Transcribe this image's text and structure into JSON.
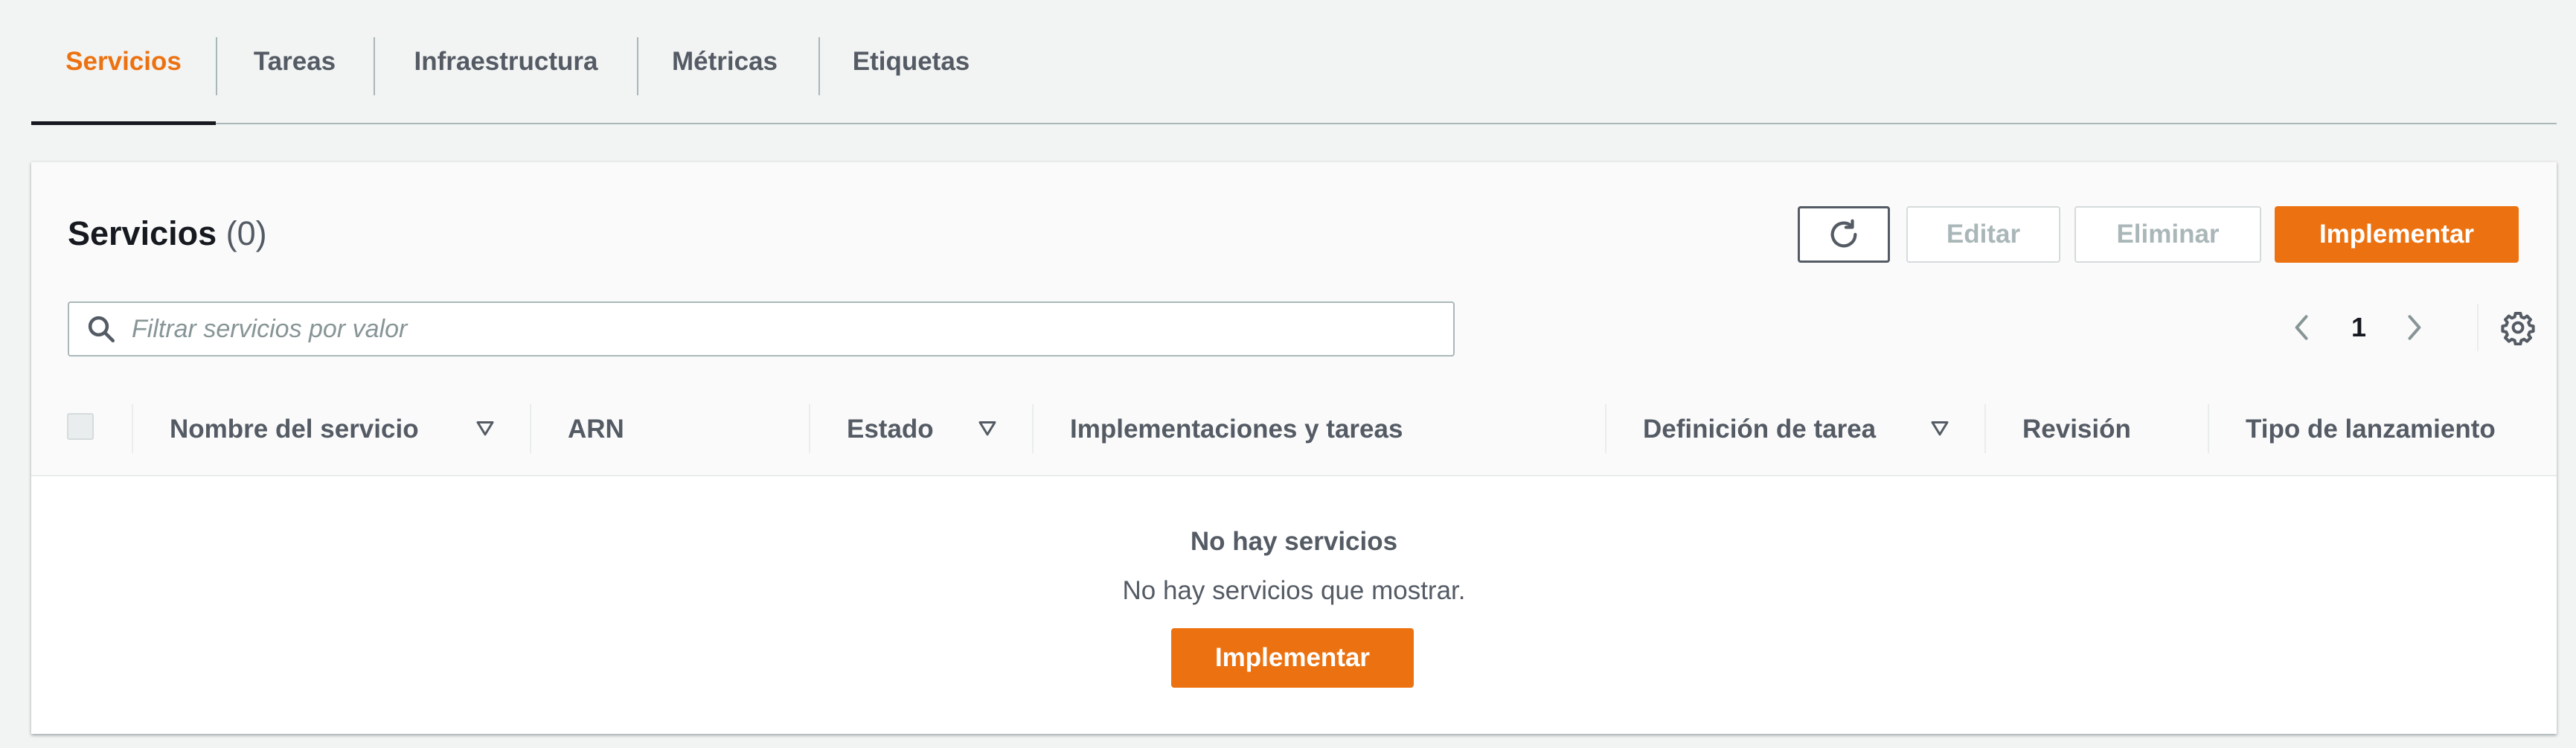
{
  "tabs": [
    {
      "label": "Servicios",
      "active": true
    },
    {
      "label": "Tareas",
      "active": false
    },
    {
      "label": "Infraestructura",
      "active": false
    },
    {
      "label": "Métricas",
      "active": false
    },
    {
      "label": "Etiquetas",
      "active": false
    }
  ],
  "panel": {
    "title": "Servicios",
    "count": "(0)"
  },
  "actions": {
    "refresh_icon": "refresh-icon",
    "edit_label": "Editar",
    "delete_label": "Eliminar",
    "deploy_label": "Implementar"
  },
  "search": {
    "placeholder": "Filtrar servicios por valor",
    "value": "",
    "icon": "search-icon"
  },
  "pagination": {
    "current_page": "1",
    "prev_icon": "chevron-left-icon",
    "next_icon": "chevron-right-icon",
    "settings_icon": "gear-icon"
  },
  "table": {
    "columns": [
      {
        "label": "Nombre del servicio",
        "sortable": true
      },
      {
        "label": "ARN",
        "sortable": false
      },
      {
        "label": "Estado",
        "sortable": true
      },
      {
        "label": "Implementaciones y tareas",
        "sortable": false
      },
      {
        "label": "Definición de tarea",
        "sortable": true
      },
      {
        "label": "Revisión",
        "sortable": false
      },
      {
        "label": "Tipo de lanzamiento",
        "sortable": false
      }
    ],
    "rows": []
  },
  "empty_state": {
    "title": "No hay servicios",
    "description": "No hay servicios que mostrar.",
    "button_label": "Implementar"
  },
  "colors": {
    "accent": "#ec7211",
    "text_primary": "#16191f",
    "text_secondary": "#545b64",
    "border": "#aab7b8"
  }
}
